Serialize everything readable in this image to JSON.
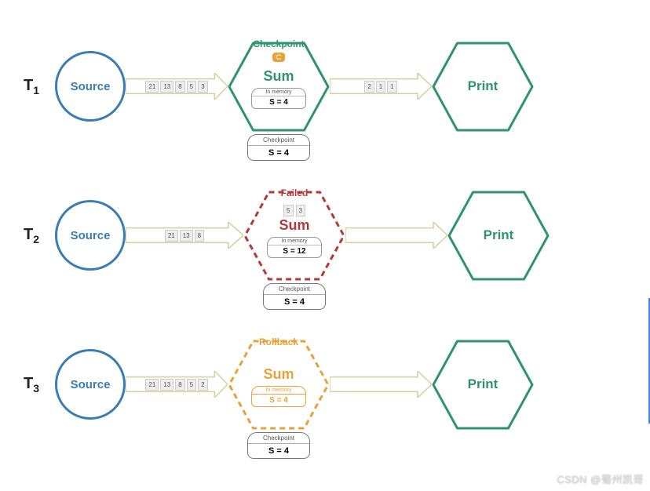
{
  "colors": {
    "blue": "#3a7db3",
    "green": "#2f9270",
    "red": "#b33a3a",
    "orange": "#e8a23a",
    "arrow": "#d4cf9a"
  },
  "rows": [
    {
      "id": "t1",
      "tlabel_main": "T",
      "tlabel_sub": "1",
      "source": "Source",
      "arrow1_tokens": [
        "21",
        "13",
        "8",
        "5",
        "3"
      ],
      "hex_label_above": "Checkpoint",
      "hex_label_color": "#2f9270",
      "hex_border_style": "solid",
      "hex_border_color": "#2f9270",
      "hex_title": "Sum",
      "hex_title_color": "#2f9270",
      "badge": "C",
      "mem_top": "In memory",
      "mem_bot": "S = 4",
      "arrow2_tokens": [
        "2",
        "1",
        "1"
      ],
      "checkpoint_top": "Checkpoint",
      "checkpoint_bot": "S = 4",
      "print": "Print"
    },
    {
      "id": "t2",
      "tlabel_main": "T",
      "tlabel_sub": "2",
      "source": "Source",
      "arrow1_tokens": [
        "21",
        "13",
        "8"
      ],
      "hex_label_above": "Failed",
      "hex_label_color": "#b33a3a",
      "hex_border_style": "dashed",
      "hex_border_color": "#b33a3a",
      "hex_title": "Sum",
      "hex_title_color": "#b33a3a",
      "small_tokens": [
        "5",
        "3"
      ],
      "mem_top": "In memory",
      "mem_bot": "S = 12",
      "arrow2_tokens": [],
      "checkpoint_top": "Checkpoint",
      "checkpoint_bot": "S = 4",
      "print": "Print"
    },
    {
      "id": "t3",
      "tlabel_main": "T",
      "tlabel_sub": "3",
      "source": "Source",
      "arrow1_tokens": [
        "21",
        "13",
        "8",
        "5",
        "2"
      ],
      "hex_label_above": "Rollback",
      "hex_label_color": "#e8a23a",
      "hex_border_style": "dashed",
      "hex_border_color": "#e8a23a",
      "hex_title": "Sum",
      "hex_title_color": "#e8a23a",
      "mem_top": "In memory",
      "mem_bot": "S = 4",
      "mem_color": "#e8a23a",
      "arrow2_tokens": [],
      "checkpoint_top": "Checkpoint",
      "checkpoint_bot": "S = 4",
      "print": "Print"
    }
  ],
  "watermark": "CSDN @蜀州凯哥"
}
